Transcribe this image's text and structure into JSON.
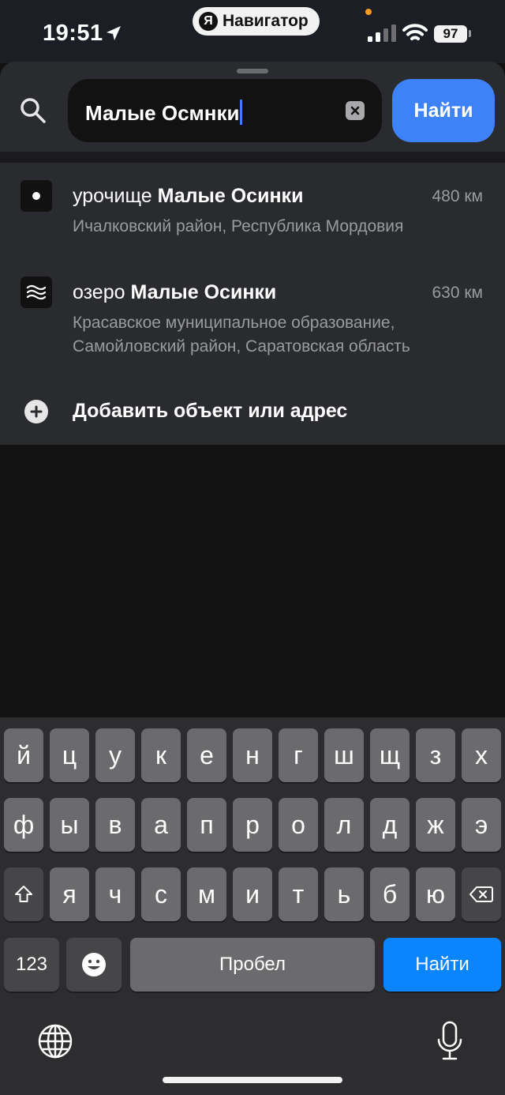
{
  "status_bar": {
    "time": "19:51",
    "app_name": "Навигатор",
    "app_logo_letter": "Я",
    "battery_level": "97",
    "icons": [
      "location-arrow-icon",
      "signal-icon",
      "wifi-icon",
      "battery-icon"
    ]
  },
  "search": {
    "query": "Малые Осмнки",
    "find_label": "Найти",
    "icons": [
      "search-icon",
      "clear-icon"
    ]
  },
  "results": [
    {
      "type_prefix": "урочище",
      "name": "Малые Осинки",
      "distance": "480 км",
      "subtitle_lines": [
        "Ичалковский район, Республика Мордовия"
      ],
      "icon": "place-dot-icon"
    },
    {
      "type_prefix": "озеро",
      "name": "Малые Осинки",
      "distance": "630 км",
      "subtitle_lines": [
        "Красавское муниципальное образование,",
        "Самойловский район, Саратовская область"
      ],
      "icon": "water-waves-icon"
    }
  ],
  "add_object": {
    "label": "Добавить объект или адрес",
    "icon": "plus-circle-icon"
  },
  "keyboard": {
    "row1": [
      "й",
      "ц",
      "у",
      "к",
      "е",
      "н",
      "г",
      "ш",
      "щ",
      "з",
      "х"
    ],
    "row2": [
      "ф",
      "ы",
      "в",
      "а",
      "п",
      "р",
      "о",
      "л",
      "д",
      "ж",
      "э"
    ],
    "row3": [
      "я",
      "ч",
      "с",
      "м",
      "и",
      "т",
      "ь",
      "б",
      "ю"
    ],
    "numbers_label": "123",
    "space_label": "Пробел",
    "return_label": "Найти",
    "icons": [
      "shift-icon",
      "backspace-icon",
      "emoji-icon",
      "globe-icon",
      "microphone-icon"
    ]
  },
  "colors": {
    "accent": "#3d82f6",
    "keyboard_return": "#0a84ff",
    "caret": "#3d7bff",
    "sheet_bg": "#2a2b2f",
    "page_bg": "#121212"
  }
}
